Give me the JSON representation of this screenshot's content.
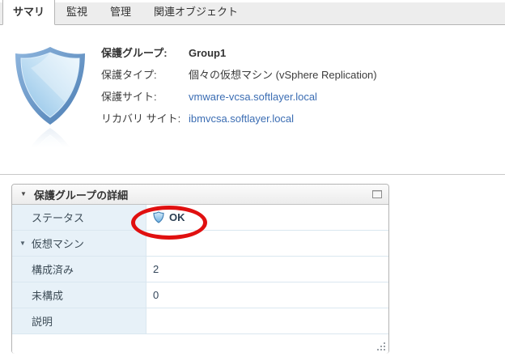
{
  "tabs": [
    {
      "label": "サマリ",
      "active": true
    },
    {
      "label": "監視",
      "active": false
    },
    {
      "label": "管理",
      "active": false
    },
    {
      "label": "関連オブジェクト",
      "active": false
    }
  ],
  "summary": {
    "fields": [
      {
        "label": "保護グループ:",
        "value": "Group1"
      },
      {
        "label": "保護タイプ:",
        "value": "個々の仮想マシン (vSphere Replication)"
      },
      {
        "label": "保護サイト:",
        "value": "vmware-vcsa.softlayer.local"
      },
      {
        "label": "リカバリ サイト:",
        "value": "ibmvcsa.softlayer.local"
      }
    ]
  },
  "panel": {
    "title": "保護グループの詳細",
    "rows": [
      {
        "label": "ステータス",
        "value": "OK"
      },
      {
        "label": "仮想マシン",
        "value": ""
      },
      {
        "label": "構成済み",
        "value": "2"
      },
      {
        "label": "未構成",
        "value": "0"
      },
      {
        "label": "説明",
        "value": ""
      }
    ]
  },
  "glyphs": {
    "triangle_down": "▼"
  },
  "icons": {
    "big_icon": "protection-group-shield-icon",
    "status_icon": "status-ok-shield-icon",
    "maximize": "maximize-icon",
    "resize": "resize-grip-icon"
  },
  "colors": {
    "link": "#3b6db3",
    "annotation_red": "#e01010",
    "label_cell_bg": "#e7f1f8",
    "status_text": "#2b3e52",
    "shield_blue": "#4b7db3"
  }
}
